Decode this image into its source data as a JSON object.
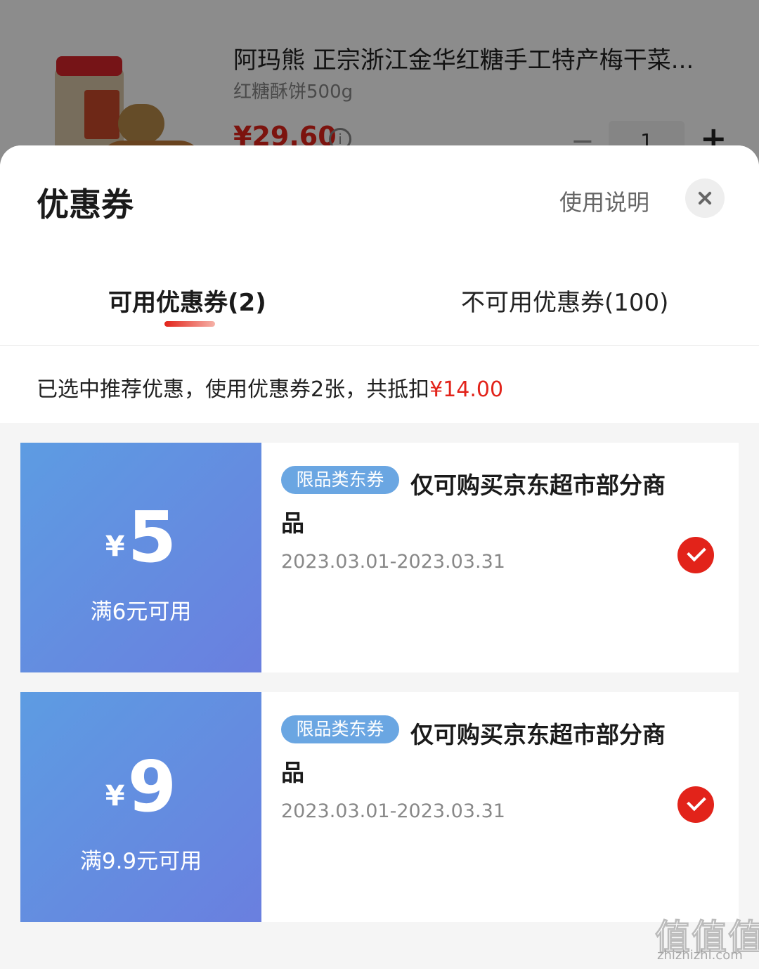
{
  "product": {
    "title": "阿玛熊 正宗浙江金华红糖手工特产梅干菜...",
    "spec": "红糖酥饼500g",
    "price": "¥29.60",
    "quantity": "1",
    "minus_label": "−",
    "plus_label": "+",
    "info_label": "i"
  },
  "sheet": {
    "title": "优惠券",
    "help_label": "使用说明"
  },
  "tabs": [
    {
      "label": "可用优惠券(2)",
      "active": true
    },
    {
      "label": "不可用优惠券(100)",
      "active": false
    }
  ],
  "summary": {
    "text": "已选中推荐优惠，使用优惠券2张，共抵扣",
    "amount": "¥14.00"
  },
  "coupons": [
    {
      "currency": "¥",
      "amount": "5",
      "condition": "满6元可用",
      "tag": "限品类东券",
      "desc_line1": "仅可购买京东超市部分商",
      "desc_line2": "品",
      "dates": "2023.03.01-2023.03.31",
      "selected": true
    },
    {
      "currency": "¥",
      "amount": "9",
      "condition": "满9.9元可用",
      "tag": "限品类东券",
      "desc_line1": "仅可购买京东超市部分商",
      "desc_line2": "品",
      "dates": "2023.03.01-2023.03.31",
      "selected": true
    }
  ],
  "watermark": {
    "text": "值值值",
    "sub": "zhizhizhi.com"
  },
  "colors": {
    "accent_red": "#e2231a",
    "coupon_blue_start": "#5d9ce2",
    "coupon_blue_end": "#6a7fdf",
    "tag_blue": "#6aa6e2"
  }
}
